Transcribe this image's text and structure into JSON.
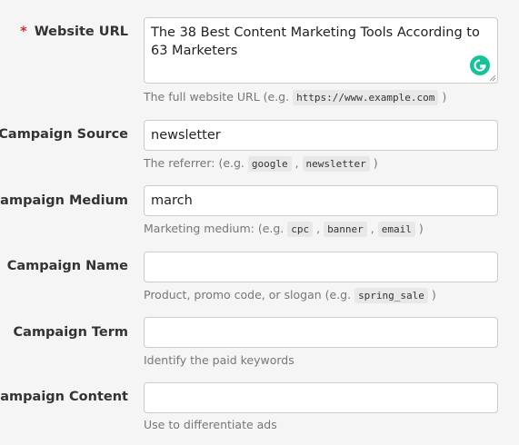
{
  "fields": [
    {
      "label": "Website URL",
      "required": true,
      "value": "The 38 Best Content Marketing Tools According to 63 Marketers",
      "help_prefix": "The full website URL (e.g. ",
      "help_codes": [
        "https://www.example.com"
      ],
      "help_suffix": " )"
    },
    {
      "label": "Campaign Source",
      "required": true,
      "value": "newsletter",
      "help_prefix": "The referrer: (e.g. ",
      "help_codes": [
        "google",
        "newsletter"
      ],
      "help_suffix": " )"
    },
    {
      "label": "Campaign Medium",
      "required": false,
      "value": "march",
      "help_prefix": "Marketing medium: (e.g. ",
      "help_codes": [
        "cpc",
        "banner",
        "email"
      ],
      "help_suffix": " )"
    },
    {
      "label": "Campaign Name",
      "required": false,
      "value": "",
      "help_prefix": "Product, promo code, or slogan (e.g. ",
      "help_codes": [
        "spring_sale"
      ],
      "help_suffix": " )"
    },
    {
      "label": "Campaign Term",
      "required": false,
      "value": "",
      "help_prefix": "Identify the paid keywords",
      "help_codes": [],
      "help_suffix": ""
    },
    {
      "label": "Campaign Content",
      "required": false,
      "value": "",
      "help_prefix": "Use to differentiate ads",
      "help_codes": [],
      "help_suffix": ""
    }
  ],
  "required_marker": "*",
  "colors": {
    "required": "#c9302c",
    "grammarly": "#15c39a"
  },
  "icons": {
    "grammarly": "grammarly-icon"
  }
}
